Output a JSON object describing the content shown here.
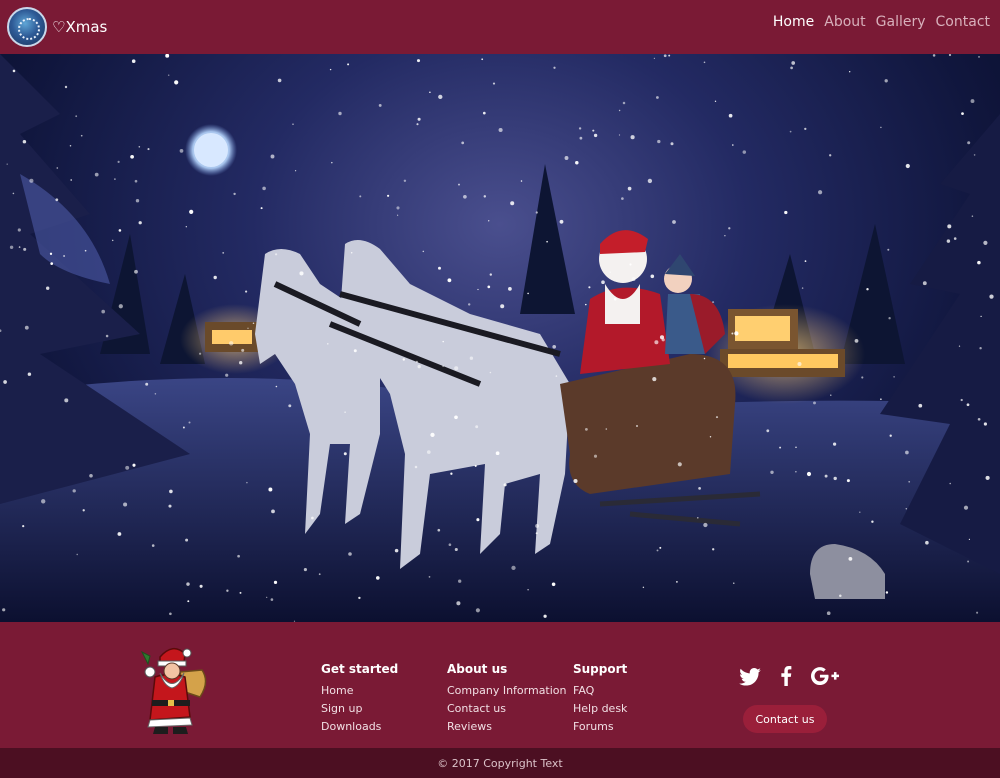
{
  "header": {
    "brand": "♡Xmas",
    "nav": [
      "Home",
      "About",
      "Gallery",
      "Contact"
    ],
    "active_nav": "Home"
  },
  "hero": {
    "image_description_icon": "christmas-sleigh-scene"
  },
  "footer": {
    "columns": [
      {
        "title": "Get started",
        "items": [
          "Home",
          "Sign up",
          "Downloads"
        ]
      },
      {
        "title": "About us",
        "items": [
          "Company Information",
          "Contact us",
          "Reviews"
        ]
      },
      {
        "title": "Support",
        "items": [
          "FAQ",
          "Help desk",
          "Forums"
        ]
      }
    ],
    "social": [
      "twitter-icon",
      "facebook-icon",
      "google-plus-icon"
    ],
    "contact_button": "Contact us",
    "copyright": "© 2017 Copyright Text"
  },
  "colors": {
    "header_bg": "#7a1a35",
    "footer_bg": "#7a1a35",
    "copyright_bg": "#4c0f22",
    "button_bg": "#9a1f3a"
  }
}
